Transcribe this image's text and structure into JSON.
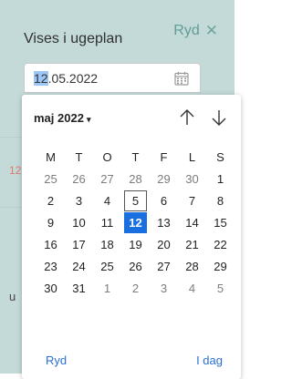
{
  "panel": {
    "title": "Vises i ugeplan",
    "clear_label": "Ryd",
    "close_glyph": "✕"
  },
  "date_input": {
    "selected_part": "12",
    "rest": ".05.2022"
  },
  "underlay": {
    "number": "12",
    "text": "u"
  },
  "datepicker": {
    "month_label": "maj 2022",
    "caret": "▾",
    "weekdays": [
      "M",
      "T",
      "O",
      "T",
      "F",
      "L",
      "S"
    ],
    "weeks": [
      [
        {
          "d": "25",
          "o": true
        },
        {
          "d": "26",
          "o": true
        },
        {
          "d": "27",
          "o": true
        },
        {
          "d": "28",
          "o": true
        },
        {
          "d": "29",
          "o": true
        },
        {
          "d": "30",
          "o": true
        },
        {
          "d": "1"
        }
      ],
      [
        {
          "d": "2"
        },
        {
          "d": "3"
        },
        {
          "d": "4"
        },
        {
          "d": "5",
          "today": true
        },
        {
          "d": "6"
        },
        {
          "d": "7"
        },
        {
          "d": "8"
        }
      ],
      [
        {
          "d": "9"
        },
        {
          "d": "10"
        },
        {
          "d": "11"
        },
        {
          "d": "12",
          "selected": true
        },
        {
          "d": "13"
        },
        {
          "d": "14"
        },
        {
          "d": "15"
        }
      ],
      [
        {
          "d": "16"
        },
        {
          "d": "17"
        },
        {
          "d": "18"
        },
        {
          "d": "19"
        },
        {
          "d": "20"
        },
        {
          "d": "21"
        },
        {
          "d": "22"
        }
      ],
      [
        {
          "d": "23"
        },
        {
          "d": "24"
        },
        {
          "d": "25"
        },
        {
          "d": "26"
        },
        {
          "d": "27"
        },
        {
          "d": "28"
        },
        {
          "d": "29"
        }
      ],
      [
        {
          "d": "30"
        },
        {
          "d": "31"
        },
        {
          "d": "1",
          "o": true
        },
        {
          "d": "2",
          "o": true
        },
        {
          "d": "3",
          "o": true
        },
        {
          "d": "4",
          "o": true
        },
        {
          "d": "5",
          "o": true
        }
      ]
    ],
    "clear_button": "Ryd",
    "today_button": "I dag"
  },
  "colors": {
    "panel_bg": "#c4dad9",
    "accent": "#5f9d97",
    "selected_day": "#1a6fe0",
    "link": "#2a6fd6"
  },
  "icons": {
    "close": "close-icon",
    "calendar": "calendar-icon",
    "prev": "arrow-up-icon",
    "next": "arrow-down-icon"
  }
}
